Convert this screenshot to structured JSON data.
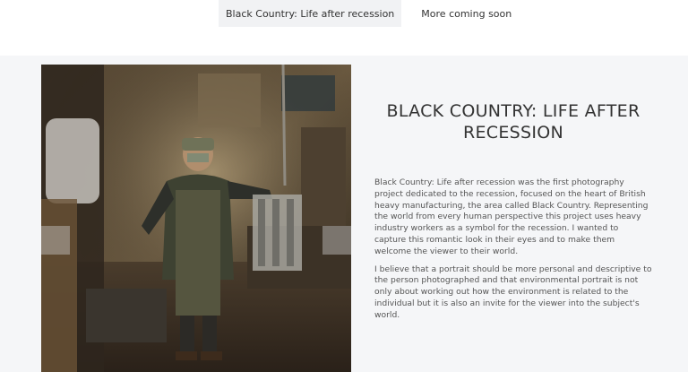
{
  "nav": {
    "tabs": [
      {
        "label": "Black Country: Life after recession",
        "active": true
      },
      {
        "label": "More coming soon",
        "active": false
      }
    ]
  },
  "article": {
    "title": "BLACK COUNTRY: LIFE AFTER RECESSION",
    "paragraphs": [
      "Black Country: Life after recession was the first photography project dedicated to the recession, focused on the heart of British heavy manufacturing, the area called Black Country. Representing the world from every human perspective this project uses heavy industry workers as a symbol for the recession. I wanted to capture this romantic look in their eyes and to make them welcome the viewer to their world.",
      "I believe that a portrait should be more personal and descriptive to the person photographed and that environmental portrait is not only about working out how the environment is related to the individual but it is also an invite for the viewer into the subject's world."
    ]
  },
  "colors": {
    "page_bg": "#f5f6f8",
    "header_bg": "#ffffff",
    "active_tab_bg": "#f1f2f4",
    "title_text": "#333333",
    "body_text": "#555555"
  }
}
